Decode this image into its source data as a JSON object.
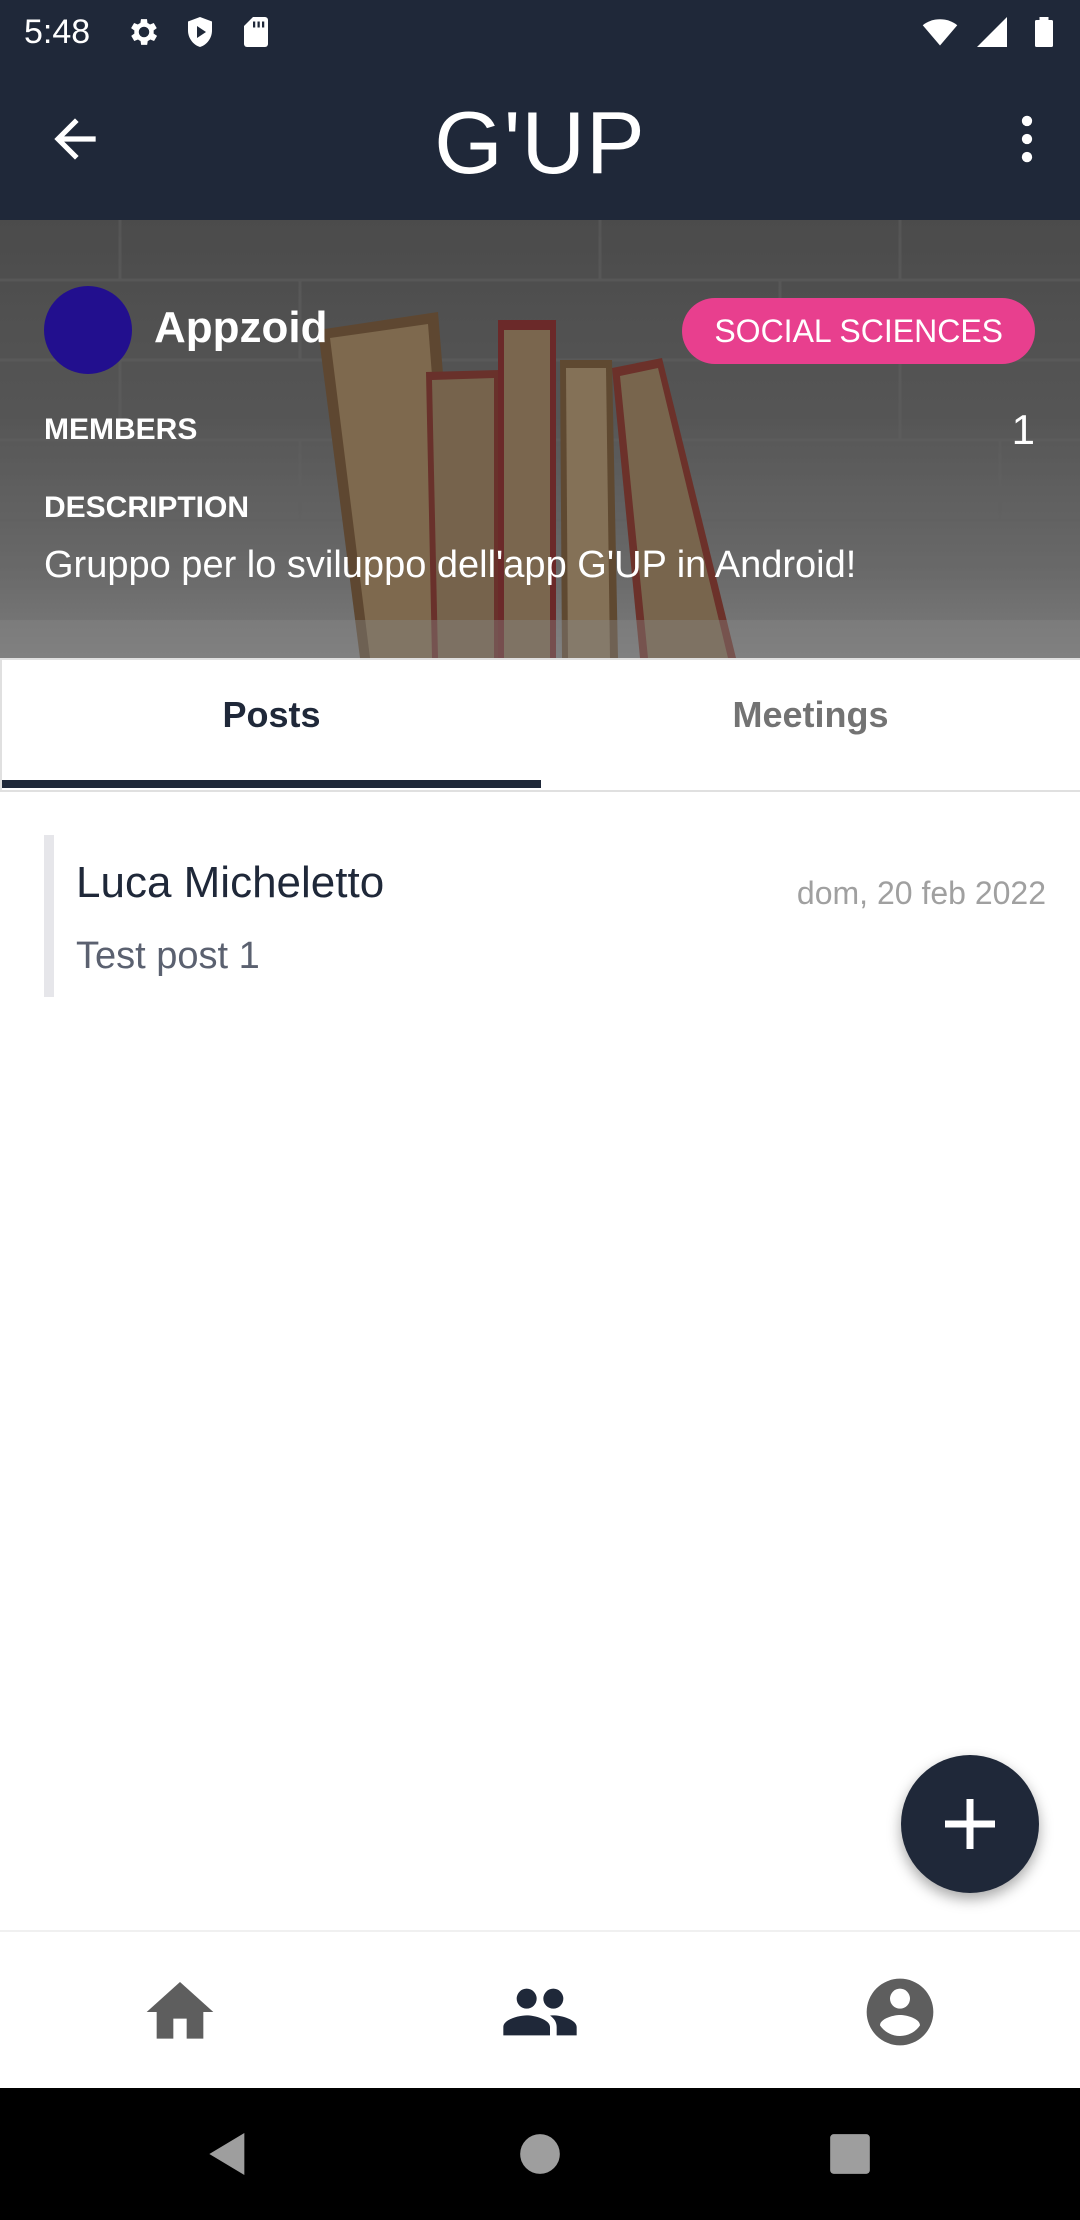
{
  "status_bar": {
    "time": "5:48",
    "icons_left": [
      "settings-icon",
      "shield-icon",
      "sd-card-icon"
    ],
    "icons_right": [
      "wifi-icon",
      "signal-icon",
      "battery-icon"
    ]
  },
  "app_bar": {
    "title": "G'UP",
    "back_icon": "arrow-back-icon",
    "menu_icon": "more-vert-icon",
    "background_color": "#1f2839"
  },
  "group": {
    "name": "Appzoid",
    "avatar_color": "#220f8e",
    "category": "SOCIAL SCIENCES",
    "category_color": "#e83f8e",
    "members_label": "MEMBERS",
    "members_count": "1",
    "description_label": "DESCRIPTION",
    "description": "Gruppo per lo sviluppo dell'app G'UP in Android!"
  },
  "tabs": [
    {
      "label": "Posts",
      "active": true
    },
    {
      "label": "Meetings",
      "active": false
    }
  ],
  "posts": [
    {
      "author": "Luca Micheletto",
      "date": "dom, 20 feb 2022",
      "body": "Test post 1"
    }
  ],
  "fab": {
    "icon": "add-icon"
  },
  "bottom_nav": [
    {
      "icon": "home-icon",
      "active": false
    },
    {
      "icon": "groups-icon",
      "active": true
    },
    {
      "icon": "account-circle-icon",
      "active": false
    }
  ],
  "system_nav": [
    "back-triangle-icon",
    "home-circle-icon",
    "recents-square-icon"
  ]
}
